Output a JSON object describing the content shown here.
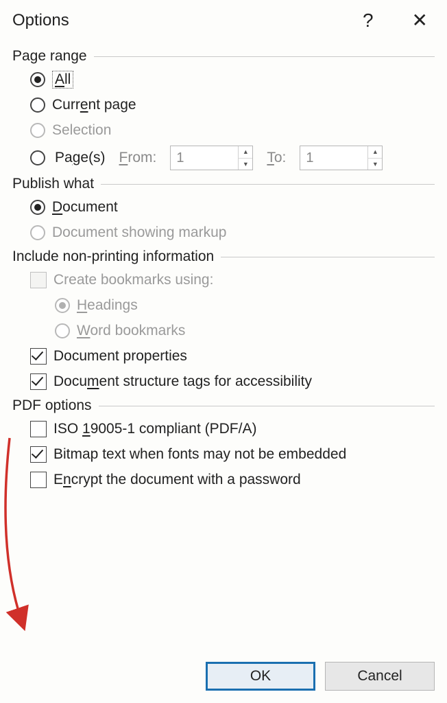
{
  "title": "Options",
  "groups": {
    "pageRange": {
      "header": "Page range",
      "all": "All",
      "currentPage": "Current page",
      "selection": "Selection",
      "pages": "Page(s)",
      "from": "From:",
      "to": "To:",
      "fromValue": "1",
      "toValue": "1"
    },
    "publishWhat": {
      "header": "Publish what",
      "document": "Document",
      "markup": "Document showing markup"
    },
    "includeNonPrinting": {
      "header": "Include non-printing information",
      "createBookmarks": "Create bookmarks using:",
      "headings": "Headings",
      "wordBookmarks": "Word bookmarks",
      "docProperties": "Document properties",
      "structureTags": "Document structure tags for accessibility"
    },
    "pdfOptions": {
      "header": "PDF options",
      "iso": "ISO 19005-1 compliant (PDF/A)",
      "bitmap": "Bitmap text when fonts may not be embedded",
      "encrypt": "Encrypt the document with a password"
    }
  },
  "buttons": {
    "ok": "OK",
    "cancel": "Cancel"
  },
  "underlineHints": {
    "all": "A",
    "currentPage": "e",
    "pages": "g",
    "from": "F",
    "to": "T",
    "document": "D",
    "headings": "H",
    "wordBookmarks": "W",
    "structureTags": "m",
    "iso": "1",
    "encrypt": "n"
  }
}
